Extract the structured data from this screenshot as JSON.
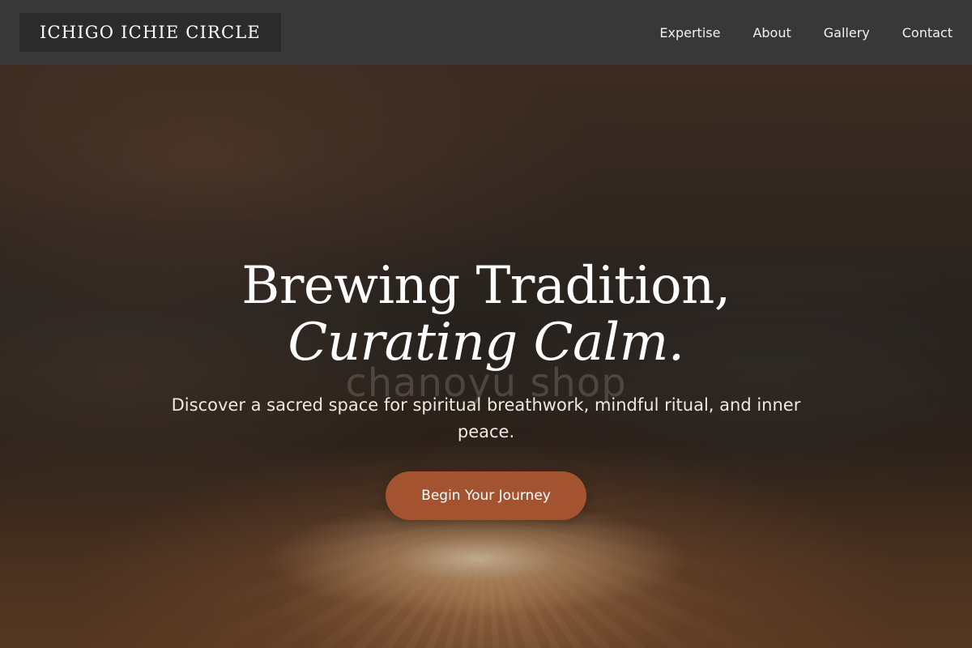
{
  "header": {
    "logo_text": "ICHIGO ICHIE CIRCLE",
    "nav": [
      {
        "label": "Expertise"
      },
      {
        "label": "About"
      },
      {
        "label": "Gallery"
      },
      {
        "label": "Contact"
      }
    ]
  },
  "hero": {
    "title_line1": "Brewing Tradition,",
    "title_line2": "Curating Calm.",
    "watermark": "chanoyu shop",
    "subtitle": "Discover a sacred space for spiritual breathwork, mindful ritual, and inner peace.",
    "cta_label": "Begin Your Journey"
  },
  "colors": {
    "header_bg": "#383838",
    "logo_bg": "#2b2b2b",
    "cta_bg": "#a3532f",
    "text_light": "#ffffff"
  }
}
